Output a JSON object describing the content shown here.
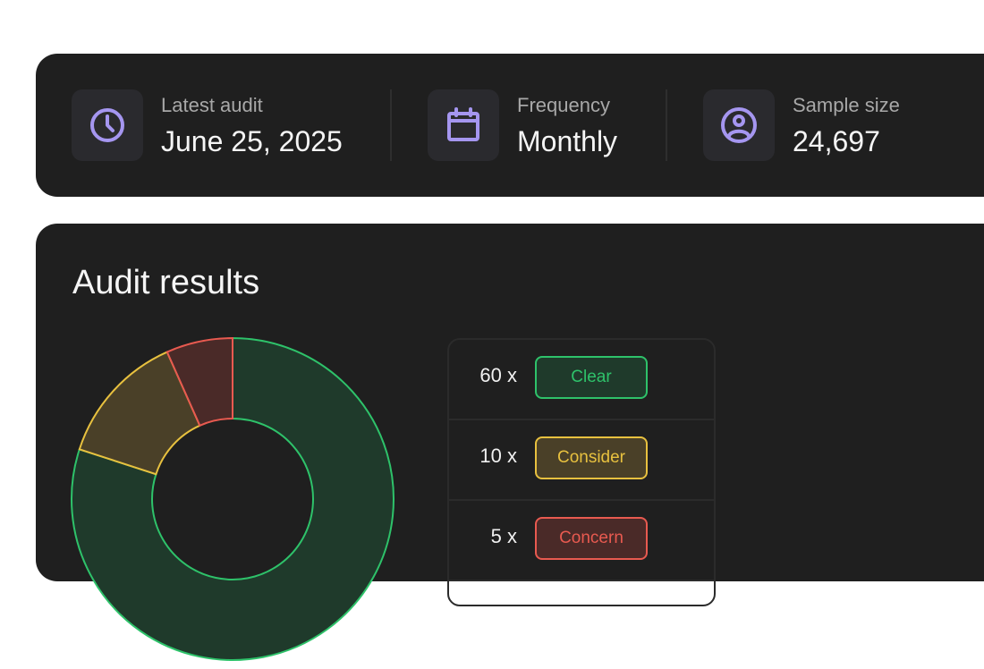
{
  "stats": [
    {
      "label": "Latest audit",
      "value": "June 25, 2025",
      "icon": "clock-icon"
    },
    {
      "label": "Frequency",
      "value": "Monthly",
      "icon": "calendar-icon"
    },
    {
      "label": "Sample size",
      "value": "24,697",
      "icon": "user-circle-icon"
    }
  ],
  "results": {
    "title": "Audit results",
    "items": [
      {
        "count": "60 x",
        "label": "Clear",
        "stroke": "#2ec26a",
        "fill": "#1f3a2b",
        "text": "#2ec26a"
      },
      {
        "count": "10 x",
        "label": "Consider",
        "stroke": "#e8c13f",
        "fill": "#4a4028",
        "text": "#e8c13f"
      },
      {
        "count": "5 x",
        "label": "Concern",
        "stroke": "#e85a50",
        "fill": "#4a2a28",
        "text": "#e85a50"
      }
    ]
  },
  "colors": {
    "accent_icon": "#a596f0",
    "card_bg": "#1f1f1f"
  }
}
